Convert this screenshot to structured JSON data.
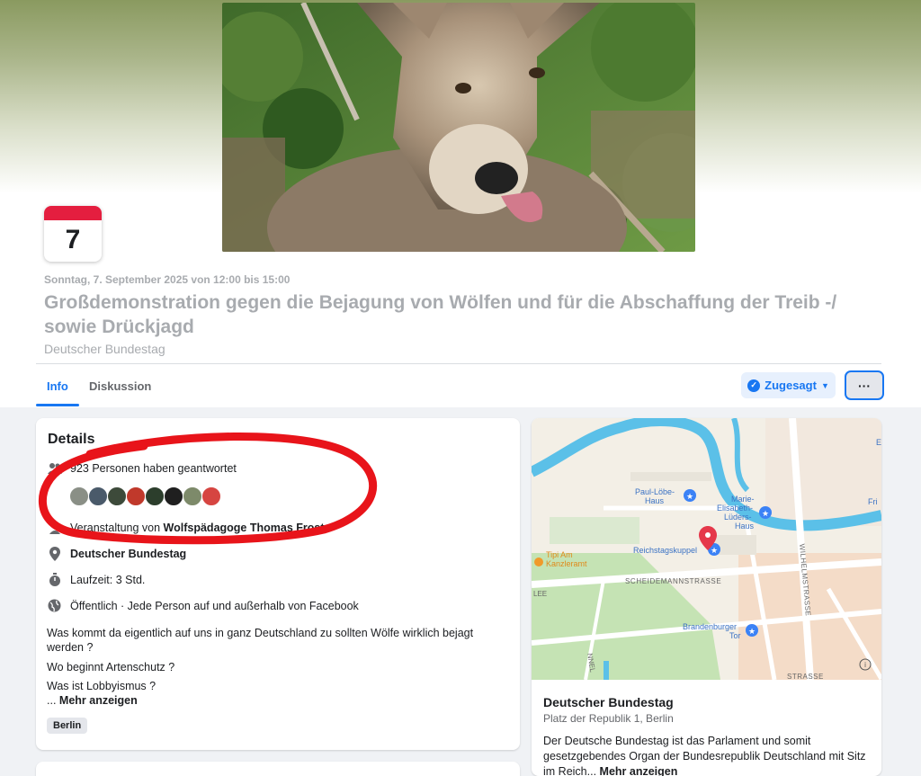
{
  "calendar": {
    "day": "7"
  },
  "event": {
    "datetime": "Sonntag, 7. September 2025 von 12:00 bis 15:00",
    "title": "Großdemonstration gegen die Bejagung von Wölfen und für die Abschaffung der Treib -/ sowie Drückjagd",
    "location": "Deutscher Bundestag"
  },
  "tabs": [
    {
      "label": "Info"
    },
    {
      "label": "Diskussion"
    }
  ],
  "actions": {
    "going_label": "Zugesagt",
    "more_label": "···"
  },
  "details": {
    "heading": "Details",
    "responded": "923 Personen haben geantwortet",
    "organizer_prefix": "Veranstaltung von ",
    "organizer_name": "Wolfspädagoge Thomas Frost",
    "place": "Deutscher Bundestag",
    "duration": "Laufzeit: 3 Std.",
    "privacy": "Öffentlich · Jede Person auf und außerhalb von Facebook",
    "description": [
      "Was kommt da eigentlich auf uns in ganz Deutschland zu sollten Wölfe wirklich bejagt werden ?",
      "Wo beginnt Artenschutz ?",
      "Was ist Lobbyismus ?"
    ],
    "more_prefix": "... ",
    "more_label": "Mehr anzeigen",
    "tag": "Berlin",
    "avatar_colors": [
      "#8a8f86",
      "#4a5a6a",
      "#3d4a3a",
      "#c0392b",
      "#2c3e2c",
      "#1f1f1f",
      "#7d8a6a",
      "#d64541"
    ]
  },
  "map": {
    "labels": {
      "paul_loebe": [
        "Paul-Löbe-",
        "Haus"
      ],
      "marie": [
        "Marie-",
        "Elisabeth-",
        "Lüders-",
        "Haus"
      ],
      "reichstag": "Reichstagskuppel",
      "tipi": [
        "Tipi Am",
        "Kanzleramt"
      ],
      "scheidemann": "SCHEIDEMANNSTRASSE",
      "wilhelm": "WILHELMSTRASSE",
      "brandenburger": [
        "Brandenburger",
        "Tor"
      ],
      "lee": "LEE",
      "nnel": "NNEL",
      "strasse": "STRASSE",
      "fri": "Fri",
      "e": "E",
      "info": "i"
    },
    "title": "Deutscher Bundestag",
    "address": "Platz der Republik 1, Berlin",
    "description": "Der Deutsche Bundestag ist das Parlament und somit gesetzgebendes Organ der Bundesrepublik Deutschland mit Sitz im Reich...",
    "more_label": "Mehr anzeigen"
  },
  "colors": {
    "accent": "#1877f2",
    "calendar_red": "#e41e3f",
    "pin_red": "#e5384a",
    "water": "#5bc0e8",
    "park": "#c5e3b4",
    "annotation_red": "#e8141a"
  }
}
